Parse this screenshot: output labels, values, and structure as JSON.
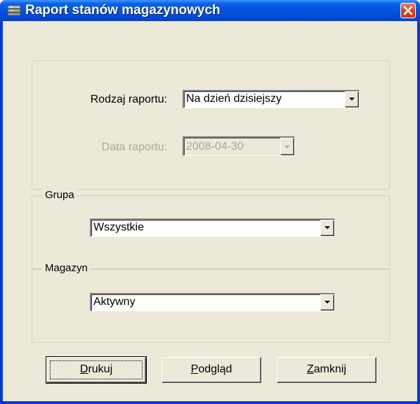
{
  "window": {
    "title": "Raport stanów magazynowych",
    "icon": "report-stack-icon",
    "close_icon": "close-icon"
  },
  "report_section": {
    "type_label": "Rodzaj raportu:",
    "type_value": "Na dzień dzisiejszy",
    "date_label": "Data raportu:",
    "date_value": "2008-04-30"
  },
  "group_section": {
    "legend": "Grupa",
    "value": "Wszystkie"
  },
  "warehouse_section": {
    "legend": "Magazyn",
    "value": "Aktywny"
  },
  "buttons": {
    "print": {
      "first": "D",
      "rest": "rukuj"
    },
    "preview": {
      "first": "P",
      "rest": "odgląd"
    },
    "close": {
      "first": "Z",
      "rest": "amknij"
    }
  },
  "colors": {
    "titlebar": "#0a5fe8",
    "dialog_bg": "#ece9d8",
    "disabled_text": "#aca899",
    "close_button": "#d54c21"
  }
}
